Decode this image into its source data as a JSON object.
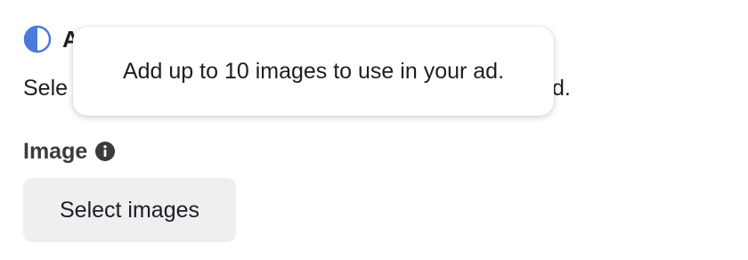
{
  "section": {
    "partial_heading": "A",
    "description_left": "Sele",
    "description_right": "d.",
    "status_icon": "half-circle-icon",
    "accent_color": "#4a7bd8"
  },
  "image_field": {
    "label": "Image",
    "info_icon": "info-icon",
    "select_button_label": "Select images"
  },
  "tooltip": {
    "text": "Add up to 10 images to use in your ad."
  }
}
